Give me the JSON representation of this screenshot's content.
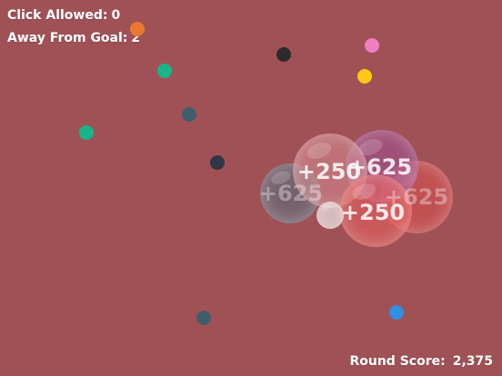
{
  "hud": {
    "click_allowed_label": "Click Allowed:",
    "click_allowed_value": "0",
    "away_from_goal_label": "Away From Goal:",
    "away_from_goal_value": "2",
    "round_score_label": "Round Score:",
    "round_score_value": "2,375"
  },
  "score_pops": [
    "+250",
    "+625",
    "+625",
    "+625",
    "+250"
  ],
  "colors": {
    "background": "#a05156",
    "orange": "#e8792e",
    "pink": "#ef7fc0",
    "yellow": "#ffc814",
    "teal": "#17b58a",
    "slate": "#3f5e6b",
    "navy": "#2f3747",
    "black": "#2b2b2b",
    "blue": "#2f8fe0"
  }
}
